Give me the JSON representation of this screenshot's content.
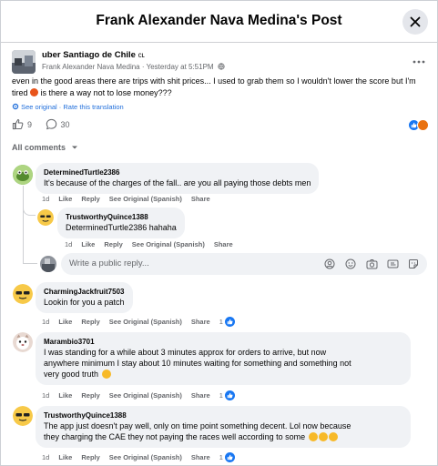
{
  "header": {
    "title": "Frank Alexander Nava Medina's Post"
  },
  "post": {
    "group": "uber Santiago de Chile",
    "group_suffix": "cʟ",
    "author": "Frank Alexander Nava Medina",
    "time": "Yesterday at 5:51PM",
    "text_a": "even in the good areas there are trips with shit prices... I used to grab them so I wouldn't lower the score but I'm tired",
    "text_b": "is there a way not to lose money???",
    "see_original": "See original",
    "rate_translation": "Rate this translation",
    "likes": "9",
    "comments": "30"
  },
  "sort_label": "All comments",
  "comments": [
    {
      "name": "DeterminedTurtle2386",
      "text": "It's because of the charges of the fall.. are you all paying those debts men",
      "time": "1d",
      "like": "Like",
      "reply": "Reply",
      "see_original": "See Original (Spanish)",
      "share": "Share"
    },
    {
      "name": "TrustworthyQuince1388",
      "text": "DeterminedTurtle2386 hahaha",
      "time": "1d",
      "like": "Like",
      "reply": "Reply",
      "see_original": "See Original (Spanish)",
      "share": "Share"
    },
    {
      "name": "CharmingJackfruit7503",
      "text": "Lookin for you a patch",
      "time": "1d",
      "like": "Like",
      "reply": "Reply",
      "see_original": "See Original (Spanish)",
      "share": "Share",
      "reactions": "1"
    },
    {
      "name": "Marambio3701",
      "text_1": "I was standing for a while about 3 minutes approx for orders to arrive, but now",
      "text_2": "anywhere minimum I stay about 10 minutes waiting for something and something not",
      "text_3": "very good truth",
      "time": "1d",
      "like": "Like",
      "reply": "Reply",
      "see_original": "See Original (Spanish)",
      "share": "Share",
      "reactions": "1"
    },
    {
      "name": "TrustworthyQuince1388",
      "text_1": "The app just doesn't pay well, only on time point something decent. Lol now because",
      "text_2": "they charging the CAE they not paying the races well according to some",
      "time": "1d",
      "like": "Like",
      "reply": "Reply",
      "see_original": "See Original (Spanish)",
      "share": "Share",
      "reactions": "1"
    }
  ],
  "reply_box": {
    "placeholder": "Write a public reply..."
  },
  "colors": {
    "accent": "#1877f2",
    "bubble": "#f0f2f5",
    "muted": "#65676b",
    "link": "#216fdb"
  }
}
